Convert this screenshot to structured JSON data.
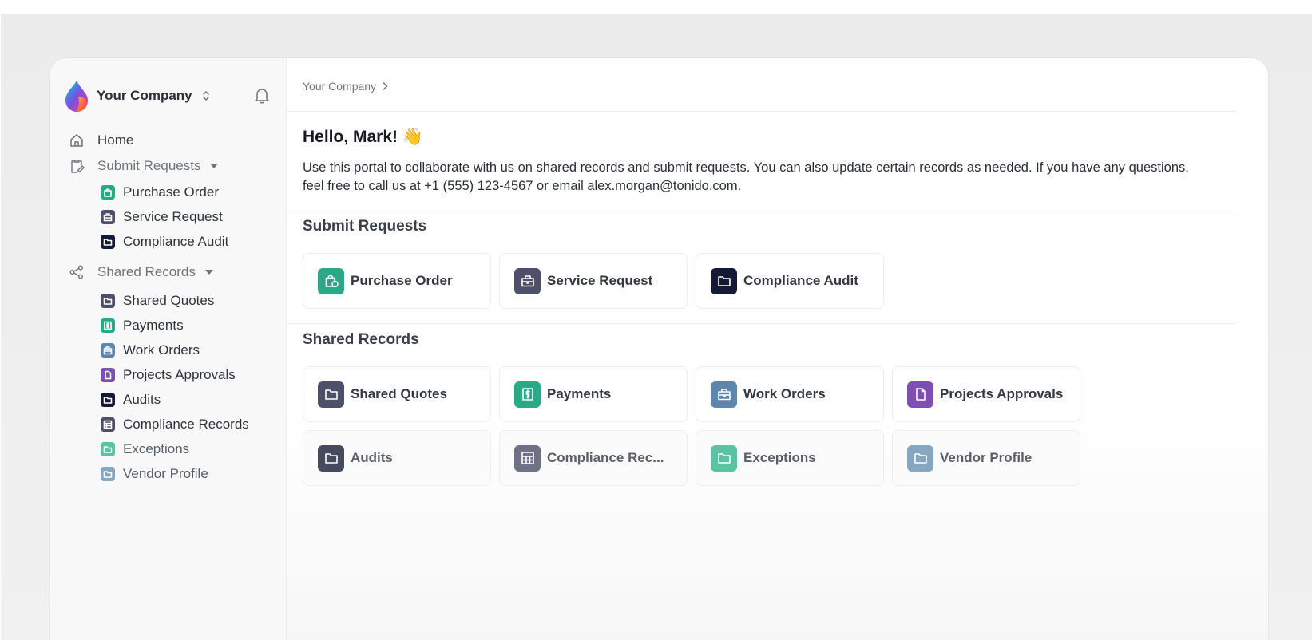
{
  "colors": {
    "green": "#2aa986",
    "slate": "#4d5068",
    "navy": "#141a33",
    "blue": "#5d86ad",
    "purple": "#7e4fb3",
    "grid_gray": "#6f7287",
    "light_green": "#5cc2a2",
    "light_blue": "#86a6c2"
  },
  "sidebar": {
    "company": "Your Company",
    "home": "Home",
    "submit_requests": "Submit Requests",
    "submit_items": [
      {
        "label": "Purchase Order",
        "icon": "shopping-bag-icon"
      },
      {
        "label": "Service Request",
        "icon": "briefcase-icon"
      },
      {
        "label": "Compliance Audit",
        "icon": "folder-icon"
      }
    ],
    "shared_records": "Shared Records",
    "shared_items": [
      {
        "label": "Shared Quotes",
        "icon": "folder-icon"
      },
      {
        "label": "Payments",
        "icon": "dollar-icon"
      },
      {
        "label": "Work Orders",
        "icon": "briefcase-icon"
      },
      {
        "label": "Projects Approvals",
        "icon": "file-icon"
      },
      {
        "label": "Audits",
        "icon": "folder-icon"
      },
      {
        "label": "Compliance Records",
        "icon": "table-icon"
      },
      {
        "label": "Exceptions",
        "icon": "folder-icon"
      },
      {
        "label": "Vendor Profile",
        "icon": "folder-icon"
      }
    ]
  },
  "main": {
    "breadcrumb": "Your Company",
    "greeting": "Hello, Mark! 👋",
    "intro": "Use this portal to collaborate with us on shared records and submit requests. You can also update certain records as needed. If you have any questions, feel free to call us at +1 (555) 123-4567 or email alex.morgan@tonido.com.",
    "submit_title": "Submit Requests",
    "submit_cards": [
      "Purchase Order",
      "Service Request",
      "Compliance Audit"
    ],
    "shared_title": "Shared Records",
    "shared_cards": [
      "Shared Quotes",
      "Payments",
      "Work Orders",
      "Projects Approvals",
      "Audits",
      "Compliance Rec...",
      "Exceptions",
      "Vendor Profile"
    ]
  }
}
